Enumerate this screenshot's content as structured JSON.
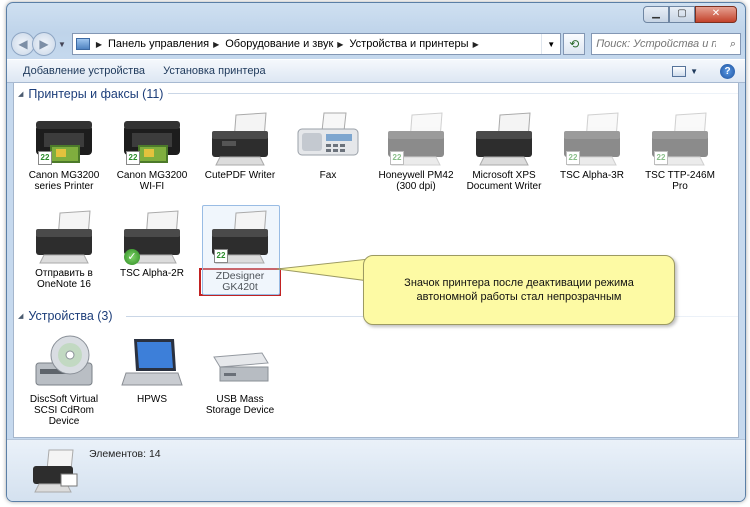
{
  "window": {
    "controls": {
      "minimize": "▁",
      "maximize": "▢",
      "close": "✕"
    }
  },
  "nav": {
    "breadcrumbs": [
      "Панель управления",
      "Оборудование и звук",
      "Устройства и принтеры"
    ],
    "search_placeholder": "Поиск: Устройства и принт..."
  },
  "toolbar": {
    "add_device": "Добавление устройства",
    "add_printer": "Установка принтера",
    "help": "?"
  },
  "groups": {
    "printers": {
      "title": "Принтеры и факсы (11)"
    },
    "devices": {
      "title": "Устройства (3)"
    }
  },
  "printers": [
    {
      "line1": "Canon MG3200",
      "line2": "series Printer",
      "icon": "inkjet-printer-icon",
      "badge": "sync"
    },
    {
      "line1": "Canon MG3200",
      "line2": "WI-FI",
      "icon": "inkjet-printer-icon",
      "badge": "sync"
    },
    {
      "line1": "CutePDF Writer",
      "line2": "",
      "icon": "printer-icon",
      "badge": ""
    },
    {
      "line1": "Fax",
      "line2": "",
      "icon": "fax-icon",
      "badge": ""
    },
    {
      "line1": "Honeywell PM42",
      "line2": "(300 dpi)",
      "icon": "printer-icon",
      "badge": "sync"
    },
    {
      "line1": "Microsoft XPS",
      "line2": "Document Writer",
      "icon": "printer-icon",
      "badge": ""
    },
    {
      "line1": "TSC Alpha-3R",
      "line2": "",
      "icon": "printer-icon",
      "badge": "sync"
    },
    {
      "line1": "TSC TTP-246M",
      "line2": "Pro",
      "icon": "printer-icon",
      "badge": "sync"
    },
    {
      "line1": "Отправить в",
      "line2": "OneNote 16",
      "icon": "printer-icon",
      "badge": ""
    },
    {
      "line1": "TSC Alpha-2R",
      "line2": "",
      "icon": "printer-icon",
      "badge": "default"
    },
    {
      "line1": "ZDesigner GK420t",
      "line2": "",
      "icon": "printer-icon",
      "badge": "sync"
    }
  ],
  "devices": [
    {
      "line1": "DiscSoft Virtual",
      "line2": "SCSI CdRom",
      "line3": "Device",
      "icon": "cdrom-icon"
    },
    {
      "line1": "HPWS",
      "line2": "",
      "line3": "",
      "icon": "laptop-icon"
    },
    {
      "line1": "USB Mass",
      "line2": "Storage Device",
      "line3": "",
      "icon": "usb-drive-icon"
    }
  ],
  "callout": {
    "line1": "Значок принтера после деактивации режима",
    "line2": "автономной работы стал непрозрачным"
  },
  "status": {
    "count": "Элементов: 14"
  }
}
